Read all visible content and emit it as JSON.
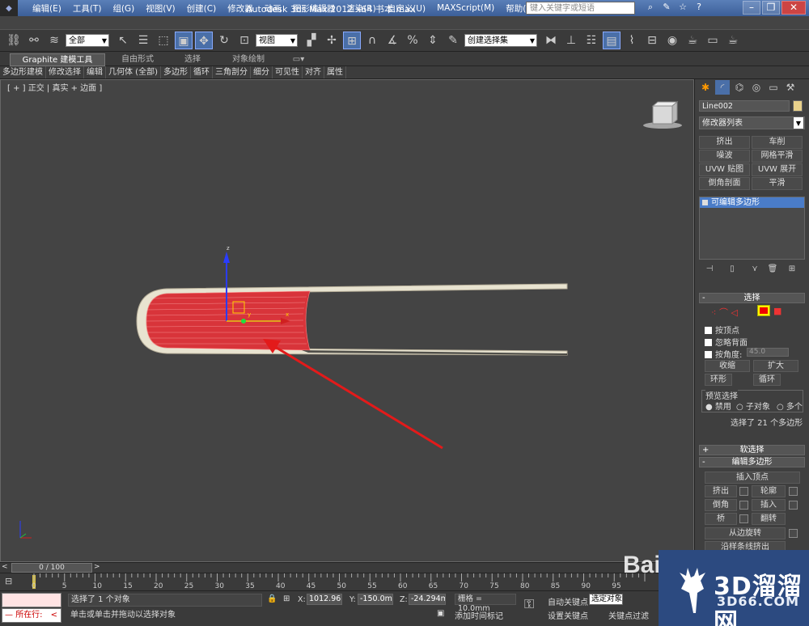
{
  "titlebar": {
    "menus": [
      "编辑(E)",
      "工具(T)",
      "组(G)",
      "视图(V)",
      "创建(C)",
      "修改器",
      "动画",
      "图形编辑器",
      "渲染(R)",
      "自定义(U)",
      "MAXScript(M)",
      "帮助(H)"
    ],
    "window_title": "Autodesk 3ds Max  2012 x64    书本.max",
    "search_placeholder": "键入关键字或短语"
  },
  "toolbar": {
    "filter_value": "全部",
    "refcoord_value": "视图",
    "named_sel_value": "创建选择集"
  },
  "ribbon": {
    "tabs": [
      "Graphite 建模工具",
      "自由形式",
      "选择",
      "对象绘制"
    ],
    "panels": [
      "多边形建模",
      "修改选择",
      "编辑",
      "几何体 (全部)",
      "多边形",
      "循环",
      "三角剖分",
      "细分",
      "可见性",
      "对齐",
      "属性"
    ]
  },
  "viewport": {
    "label": "[ + ] 正交 | 真实 + 边面 ]",
    "gizmo_x": "x",
    "gizmo_y": "y",
    "gizmo_z": "z",
    "colors": {
      "red_fill": "#d8343a",
      "book_edge": "#e8e3d0",
      "arrow": "#e31a1a",
      "bg": "#444444"
    }
  },
  "command_panel": {
    "object_name": "Line002",
    "modifier_list": "修改器列表",
    "modifier_buttons": [
      "挤出",
      "车削",
      "噪波",
      "网格平滑",
      "UVW 贴图",
      "UVW 展开",
      "倒角剖面",
      "平滑"
    ],
    "stack_item": "可编辑多边形",
    "selection": {
      "title": "选择",
      "by_vertex": "按顶点",
      "ignore_backfacing": "忽略背面",
      "by_angle": "按角度:",
      "angle_value": "45.0",
      "shrink": "收缩",
      "grow": "扩大",
      "ring": "环形",
      "loop": "循环",
      "preview_label": "预览选择",
      "preview_off": "禁用",
      "preview_subobj": "子对象",
      "preview_multi": "多个",
      "selected_info": "选择了 21 个多边形"
    },
    "soft_selection": "软选择",
    "edit_polygons": {
      "title": "编辑多边形",
      "insert_vertex": "插入顶点",
      "extrude": "挤出",
      "outline": "轮廓",
      "bevel": "倒角",
      "inset": "插入",
      "bridge": "桥",
      "flip": "翻转",
      "hinge": "从边旋转",
      "extrude_along": "沿样条线挤出"
    }
  },
  "timeline": {
    "frame_display": "0 / 100",
    "ticks": [
      "0",
      "5",
      "10",
      "15",
      "20",
      "25",
      "30",
      "35",
      "40",
      "45",
      "50",
      "55",
      "60",
      "65",
      "70",
      "75",
      "80",
      "85",
      "90",
      "95"
    ]
  },
  "status": {
    "now_label": "所在行:",
    "selected": "选择了 1 个对象",
    "prompt": "单击或单击并拖动以选择对象",
    "x_label": "X:",
    "x_value": "1012.965m",
    "y_label": "Y:",
    "y_value": "-150.0mm",
    "z_label": "Z:",
    "z_value": "-24.294mm",
    "grid": "栅格 = 10.0mm",
    "add_time_tag": "添加时间标记",
    "auto_key": "自动关键点",
    "set_key": "设置关键点",
    "selected_obj": "选定对象",
    "key_filters": "关键点过滤"
  },
  "watermark": {
    "brand": "3D溜溜网",
    "site": "3D66.COM",
    "baidu": "Bai"
  }
}
